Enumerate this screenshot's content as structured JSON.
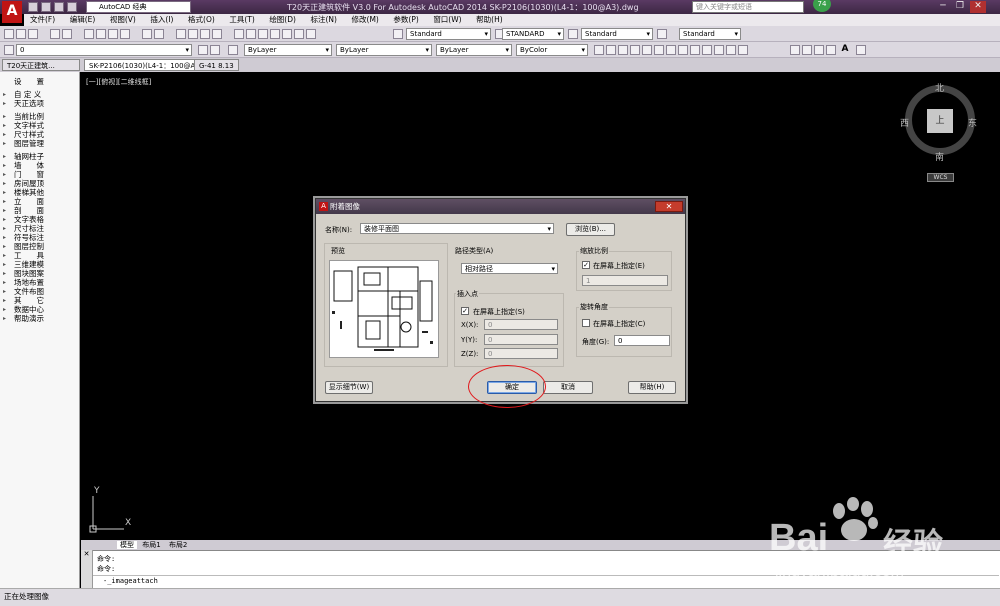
{
  "titlebar": {
    "title": "T20天正建筑软件 V3.0 For Autodesk AutoCAD 2014    SK-P2106(1030)(L4-1：100@A3).dwg",
    "workspace": "AutoCAD 经典",
    "search_placeholder": "键入关键字或短语",
    "badge": "74",
    "minimize": "─",
    "restore": "❐",
    "close": "✕"
  },
  "menubar": [
    "文件(F)",
    "编辑(E)",
    "视图(V)",
    "插入(I)",
    "格式(O)",
    "工具(T)",
    "绘图(D)",
    "标注(N)",
    "修改(M)",
    "参数(P)",
    "窗口(W)",
    "帮助(H)"
  ],
  "toolbar": {
    "text_style": "Standard",
    "dim_style": "STANDARD",
    "table_style": "Standard",
    "mleader_style": "Standard",
    "layer": "0",
    "color": "ByLayer",
    "linetype": "ByLayer",
    "lineweight": "ByLayer",
    "plotstyle": "ByColor"
  },
  "doctabs": {
    "panel_title": "T20天正建筑...",
    "file_tab": "SK-P2106(1030)(L4-1：100@A3)",
    "sheet_tab": "G-41  8.13"
  },
  "sidebar": {
    "header": "设　　置",
    "items": [
      "自 定 义",
      "天正选项",
      "当前比例",
      "文字样式",
      "尺寸样式",
      "图层管理",
      "轴网柱子",
      "墙　　体",
      "门　　窗",
      "房间屋顶",
      "楼梯其他",
      "立　　面",
      "剖　　面",
      "文字表格",
      "尺寸标注",
      "符号标注",
      "图层控制",
      "工　　具",
      "三维建模",
      "图块图案",
      "场地布置",
      "文件布图",
      "其　　它",
      "数据中心",
      "帮助演示"
    ]
  },
  "viewport": {
    "label": "[一][俯视][二维线框]",
    "compass": {
      "north": "北",
      "south": "南",
      "east": "东",
      "west": "西",
      "top": "上"
    },
    "wcs": "WCS",
    "ucs_x": "X",
    "ucs_y": "Y"
  },
  "model_tabs": [
    "模型",
    "布局1",
    "布局2"
  ],
  "command": {
    "history": [
      "命令:",
      "命令:"
    ],
    "current": "-_imageattach"
  },
  "status": "正在处理图像",
  "dialog": {
    "title": "附着图像",
    "name_label": "名称(N):",
    "name_value": "装修平面图",
    "browse": "浏览(B)...",
    "preview_label": "预览",
    "path_type_label": "路径类型(A)",
    "path_type_value": "相对路径",
    "insert_point_label": "插入点",
    "insert_on_screen": "在屏幕上指定(S)",
    "insert_on_screen_checked": true,
    "x_label": "X(X):",
    "y_label": "Y(Y):",
    "z_label": "Z(Z):",
    "x_value": "0",
    "y_value": "0",
    "z_value": "0",
    "scale_label": "缩放比例",
    "scale_on_screen": "在屏幕上指定(E)",
    "scale_on_screen_checked": true,
    "scale_value": "1",
    "rotation_label": "旋转角度",
    "rotation_on_screen": "在屏幕上指定(C)",
    "rotation_on_screen_checked": false,
    "angle_label": "角度(G):",
    "angle_value": "0",
    "show_details": "显示细节(W)",
    "ok": "确定",
    "cancel": "取消",
    "help": "帮助(H)"
  },
  "watermark": {
    "brand": "Bai",
    "brand_cn": "经验",
    "url": "jingyan.baidu.com"
  },
  "colors": {
    "title_bg": "#4a3252",
    "dialog_bg": "#d4d0c8",
    "highlight_circle": "#e0181b",
    "accent_red": "#c01414"
  }
}
